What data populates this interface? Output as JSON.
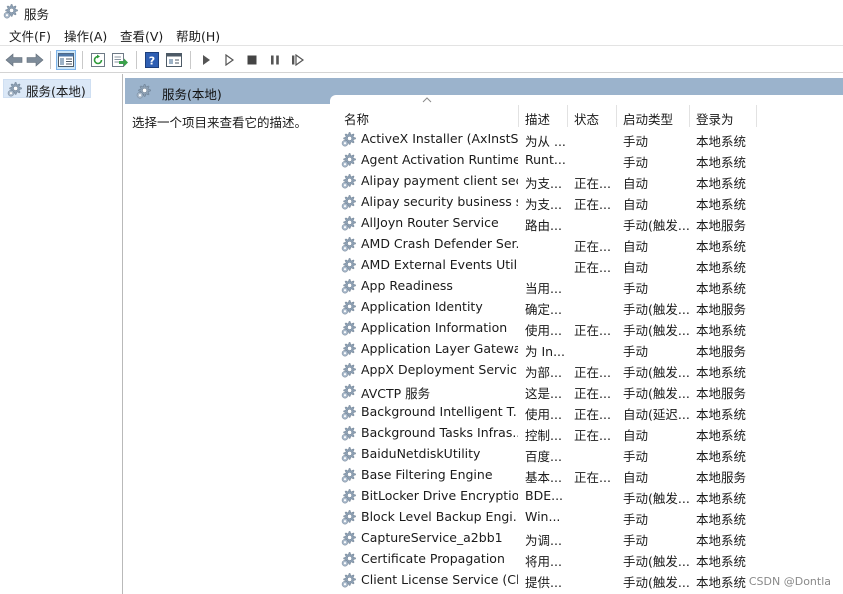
{
  "window": {
    "title": "服务"
  },
  "menu": [
    "文件(F)",
    "操作(A)",
    "查看(V)",
    "帮助(H)"
  ],
  "tree": {
    "selected": "服务(本地)"
  },
  "pane": {
    "title": "服务(本地)",
    "hint": "选择一个项目来查看它的描述。"
  },
  "columns": {
    "name": "名称",
    "desc": "描述",
    "status": "状态",
    "startup": "启动类型",
    "logon": "登录为"
  },
  "rows": [
    {
      "name": "ActiveX Installer (AxInstSV)",
      "desc": "为从 ...",
      "status": "",
      "startup": "手动",
      "logon": "本地系统"
    },
    {
      "name": "Agent Activation Runtime...",
      "desc": "Runt...",
      "status": "",
      "startup": "手动",
      "logon": "本地系统"
    },
    {
      "name": "Alipay payment client sec...",
      "desc": "为支...",
      "status": "正在...",
      "startup": "自动",
      "logon": "本地系统"
    },
    {
      "name": "Alipay security business s...",
      "desc": "为支...",
      "status": "正在...",
      "startup": "自动",
      "logon": "本地系统"
    },
    {
      "name": "AllJoyn Router Service",
      "desc": "路由...",
      "status": "",
      "startup": "手动(触发...",
      "logon": "本地服务"
    },
    {
      "name": "AMD Crash Defender Ser...",
      "desc": "",
      "status": "正在...",
      "startup": "自动",
      "logon": "本地系统"
    },
    {
      "name": "AMD External Events Utility",
      "desc": "",
      "status": "正在...",
      "startup": "自动",
      "logon": "本地系统"
    },
    {
      "name": "App Readiness",
      "desc": "当用...",
      "status": "",
      "startup": "手动",
      "logon": "本地系统"
    },
    {
      "name": "Application Identity",
      "desc": "确定...",
      "status": "",
      "startup": "手动(触发...",
      "logon": "本地服务"
    },
    {
      "name": "Application Information",
      "desc": "使用...",
      "status": "正在...",
      "startup": "手动(触发...",
      "logon": "本地系统"
    },
    {
      "name": "Application Layer Gatewa...",
      "desc": "为 In...",
      "status": "",
      "startup": "手动",
      "logon": "本地服务"
    },
    {
      "name": "AppX Deployment Servic...",
      "desc": "为部...",
      "status": "正在...",
      "startup": "手动(触发...",
      "logon": "本地系统"
    },
    {
      "name": "AVCTP 服务",
      "desc": "这是...",
      "status": "正在...",
      "startup": "手动(触发...",
      "logon": "本地服务"
    },
    {
      "name": "Background Intelligent T...",
      "desc": "使用...",
      "status": "正在...",
      "startup": "自动(延迟...",
      "logon": "本地系统"
    },
    {
      "name": "Background Tasks Infras...",
      "desc": "控制...",
      "status": "正在...",
      "startup": "自动",
      "logon": "本地系统"
    },
    {
      "name": "BaiduNetdiskUtility",
      "desc": "百度...",
      "status": "",
      "startup": "手动",
      "logon": "本地系统"
    },
    {
      "name": "Base Filtering Engine",
      "desc": "基本...",
      "status": "正在...",
      "startup": "自动",
      "logon": "本地服务"
    },
    {
      "name": "BitLocker Drive Encryptio...",
      "desc": "BDE...",
      "status": "",
      "startup": "手动(触发...",
      "logon": "本地系统"
    },
    {
      "name": "Block Level Backup Engi...",
      "desc": "Win...",
      "status": "",
      "startup": "手动",
      "logon": "本地系统"
    },
    {
      "name": "CaptureService_a2bb1",
      "desc": "为调...",
      "status": "",
      "startup": "手动",
      "logon": "本地系统"
    },
    {
      "name": "Certificate Propagation",
      "desc": "将用...",
      "status": "",
      "startup": "手动(触发...",
      "logon": "本地系统"
    },
    {
      "name": "Client License Service (Cli...",
      "desc": "提供...",
      "status": "",
      "startup": "手动(触发...",
      "logon": "本地系统"
    }
  ],
  "watermark": "CSDN @Dontla",
  "icons": [
    "back-arrow-icon",
    "forward-arrow-icon",
    "console-tree-icon",
    "refresh-icon",
    "export-list-icon",
    "help-icon",
    "properties-icon",
    "start-icon",
    "start-paused-icon",
    "stop-icon",
    "pause-icon",
    "restart-icon",
    "gear-icon"
  ],
  "colors": {
    "pane_header": "#9bb3cc",
    "selection": "#dbe8f7",
    "toolbar_active": "#cde6f7"
  }
}
